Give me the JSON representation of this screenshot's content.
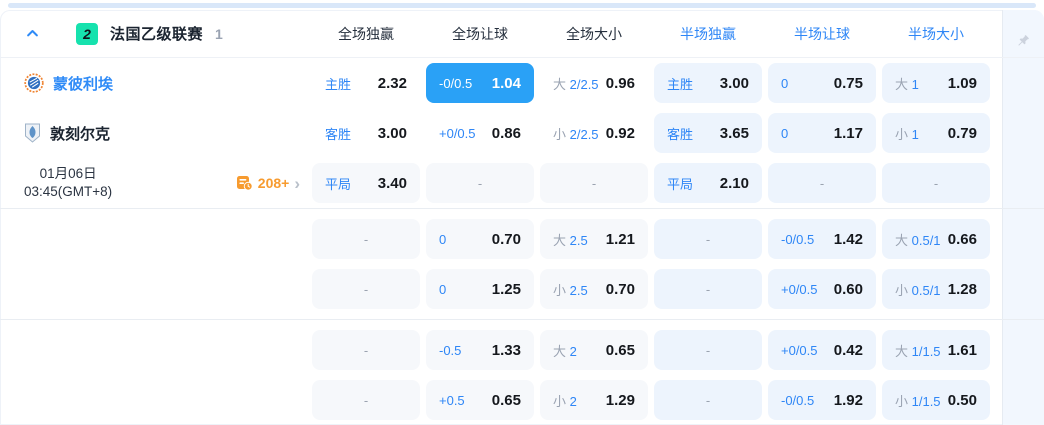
{
  "colors": {
    "accent_blue": "#2e86f6",
    "selected_cell_bg": "#2aa1f6",
    "orange": "#f79b2f",
    "badge_teal": "#16e2ae"
  },
  "header": {
    "collapse_icon": "chevron-up-icon",
    "league_badge_text": "2",
    "league_name": "法国乙级联赛",
    "match_count": "1",
    "pin_icon": "pin-icon",
    "columns": [
      {
        "label": "全场独赢"
      },
      {
        "label": "全场让球"
      },
      {
        "label": "全场大小"
      },
      {
        "label": "半场独赢"
      },
      {
        "label": "半场让球"
      },
      {
        "label": "半场大小"
      }
    ]
  },
  "match": {
    "home_team": "蒙彼利埃",
    "away_team": "敦刻尔克",
    "date": "01月06日",
    "time": "03:45(GMT+8)",
    "more_markets_count": "208+",
    "more_markets_icon": "markets-clock-icon",
    "more_markets_chevron": "›"
  },
  "odds": {
    "blocks": [
      {
        "rows": [
          [
            {
              "label": "主胜",
              "value": "2.32",
              "bg": "plain"
            },
            {
              "label": "-0/0.5",
              "value": "1.04",
              "bg": "selected"
            },
            {
              "pre": "大",
              "label": "2/2.5",
              "value": "0.96",
              "bg": "plain"
            },
            {
              "label": "主胜",
              "value": "3.00",
              "bg": "half"
            },
            {
              "label": "0",
              "value": "0.75",
              "bg": "half"
            },
            {
              "pre": "大",
              "label": "1",
              "value": "1.09",
              "bg": "half"
            }
          ],
          [
            {
              "label": "客胜",
              "value": "3.00",
              "bg": "plain"
            },
            {
              "label": "+0/0.5",
              "value": "0.86",
              "bg": "plain"
            },
            {
              "pre": "小",
              "label": "2/2.5",
              "value": "0.92",
              "bg": "plain"
            },
            {
              "label": "客胜",
              "value": "3.65",
              "bg": "half"
            },
            {
              "label": "0",
              "value": "1.17",
              "bg": "half"
            },
            {
              "pre": "小",
              "label": "1",
              "value": "0.79",
              "bg": "half"
            }
          ],
          [
            {
              "label": "平局",
              "value": "3.40",
              "bg": "muted"
            },
            {
              "dash": true,
              "bg": "muted"
            },
            {
              "dash": true,
              "bg": "muted"
            },
            {
              "label": "平局",
              "value": "2.10",
              "bg": "half"
            },
            {
              "dash": true,
              "bg": "half"
            },
            {
              "dash": true,
              "bg": "half"
            }
          ]
        ]
      },
      {
        "rows": [
          [
            {
              "dash": true,
              "bg": "muted"
            },
            {
              "label": "0",
              "value": "0.70",
              "bg": "muted"
            },
            {
              "pre": "大",
              "label": "2.5",
              "value": "1.21",
              "bg": "muted"
            },
            {
              "dash": true,
              "bg": "half"
            },
            {
              "label": "-0/0.5",
              "value": "1.42",
              "bg": "half"
            },
            {
              "pre": "大",
              "label": "0.5/1",
              "value": "0.66",
              "bg": "half"
            }
          ],
          [
            {
              "dash": true,
              "bg": "muted"
            },
            {
              "label": "0",
              "value": "1.25",
              "bg": "muted"
            },
            {
              "pre": "小",
              "label": "2.5",
              "value": "0.70",
              "bg": "muted"
            },
            {
              "dash": true,
              "bg": "half"
            },
            {
              "label": "+0/0.5",
              "value": "0.60",
              "bg": "half"
            },
            {
              "pre": "小",
              "label": "0.5/1",
              "value": "1.28",
              "bg": "half"
            }
          ]
        ]
      },
      {
        "rows": [
          [
            {
              "dash": true,
              "bg": "muted"
            },
            {
              "label": "-0.5",
              "value": "1.33",
              "bg": "muted"
            },
            {
              "pre": "大",
              "label": "2",
              "value": "0.65",
              "bg": "muted"
            },
            {
              "dash": true,
              "bg": "half"
            },
            {
              "label": "+0/0.5",
              "value": "0.42",
              "bg": "half"
            },
            {
              "pre": "大",
              "label": "1/1.5",
              "value": "1.61",
              "bg": "half"
            }
          ],
          [
            {
              "dash": true,
              "bg": "muted"
            },
            {
              "label": "+0.5",
              "value": "0.65",
              "bg": "muted"
            },
            {
              "pre": "小",
              "label": "2",
              "value": "1.29",
              "bg": "muted"
            },
            {
              "dash": true,
              "bg": "half"
            },
            {
              "label": "-0/0.5",
              "value": "1.92",
              "bg": "half"
            },
            {
              "pre": "小",
              "label": "1/1.5",
              "value": "0.50",
              "bg": "half"
            }
          ]
        ]
      }
    ]
  }
}
